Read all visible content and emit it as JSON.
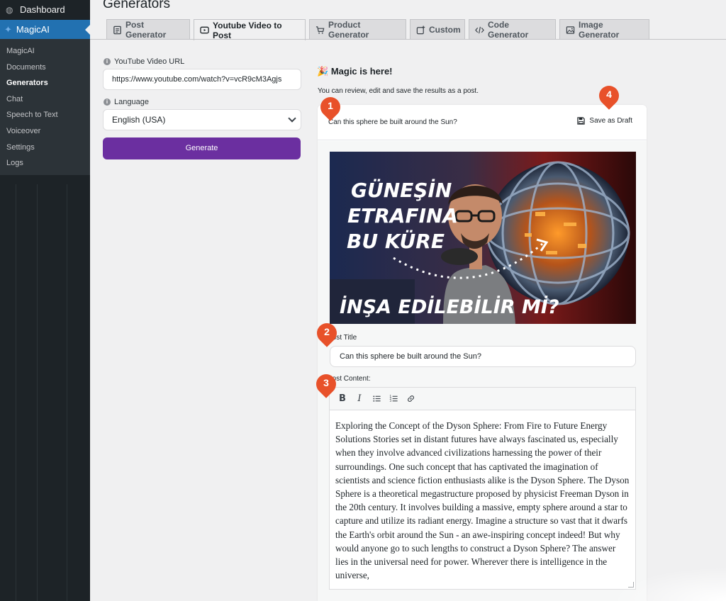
{
  "sidebar": {
    "dashboard_label": "Dashboard",
    "plugin_label": "MagicAI",
    "submenu": [
      {
        "label": "MagicAI"
      },
      {
        "label": "Documents"
      },
      {
        "label": "Generators",
        "current": true
      },
      {
        "label": "Chat"
      },
      {
        "label": "Speech to Text"
      },
      {
        "label": "Voiceover"
      },
      {
        "label": "Settings"
      },
      {
        "label": "Logs"
      }
    ]
  },
  "page": {
    "title": "Generators"
  },
  "tabs": [
    {
      "label": "Post Generator",
      "icon": "document-icon"
    },
    {
      "label": "Youtube Video to Post",
      "icon": "youtube-icon",
      "active": true
    },
    {
      "label": "Product Generator",
      "icon": "cart-icon"
    },
    {
      "label": "Custom",
      "icon": "custom-icon"
    },
    {
      "label": "Code Generator",
      "icon": "code-icon"
    },
    {
      "label": "Image Generator",
      "icon": "image-icon"
    }
  ],
  "form": {
    "url_label": "YouTube Video URL",
    "url_value": "https://www.youtube.com/watch?v=vcR9cM3Agjs",
    "language_label": "Language",
    "language_value": "English (USA)",
    "generate_label": "Generate"
  },
  "result": {
    "heading": "Magic is here!",
    "heading_emoji": "🎉",
    "subtitle": "You can review, edit and save the results as a post.",
    "question": "Can this sphere be built around the Sun?",
    "save_draft_label": "Save as Draft",
    "thumbnail_text": [
      "GÜNEŞİN",
      "ETRAFINA",
      "BU KÜRE",
      "İNŞA EDİLEBİLİR Mİ?"
    ],
    "post_title_label": "Post Title",
    "post_title_value": "Can this sphere be built around the Sun?",
    "post_content_label": "Post Content:",
    "toolbar": [
      "B",
      "I",
      "bulleted-list-icon",
      "numbered-list-icon",
      "link-icon"
    ],
    "content": "Exploring the Concept of the Dyson Sphere: From Fire to Future Energy Solutions Stories set in distant futures have always fascinated us, especially when they involve advanced civilizations harnessing the power of their surroundings. One such concept that has captivated the imagination of scientists and science fiction enthusiasts alike is the Dyson Sphere. The Dyson Sphere is a theoretical megastructure proposed by physicist Freeman Dyson in the 20th century. It involves building a massive, empty sphere around a star to capture and utilize its radiant energy. Imagine a structure so vast that it dwarfs the Earth's orbit around the Sun - an awe-inspiring concept indeed! But why would anyone go to such lengths to construct a Dyson Sphere? The answer lies in the universal need for power. Wherever there is intelligence in the universe,"
  },
  "markers": [
    "1",
    "2",
    "3",
    "4"
  ],
  "colors": {
    "accent": "#2271b1",
    "generate": "#6b2fa0",
    "marker": "#e8512a"
  }
}
